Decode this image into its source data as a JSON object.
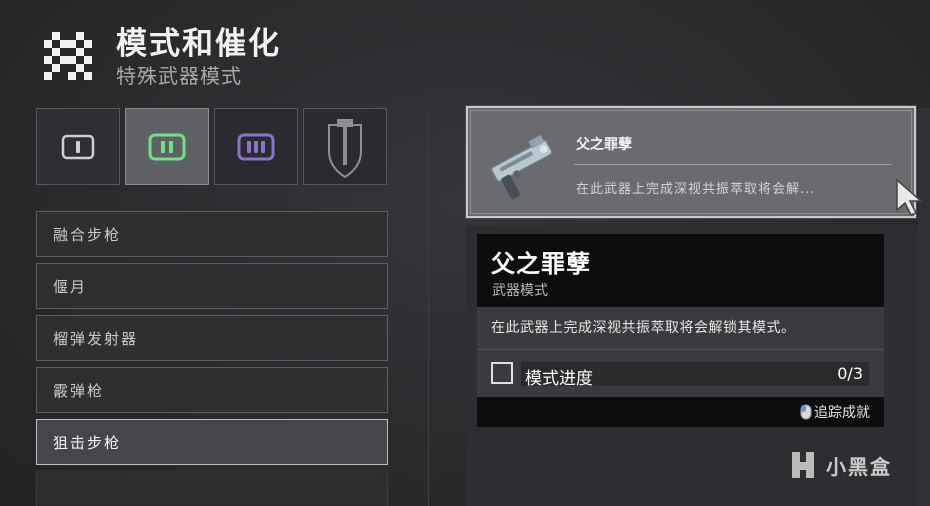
{
  "header": {
    "title": "模式和催化",
    "subtitle": "特殊武器模式",
    "icon": "checker-icon"
  },
  "ammo_tiles": [
    {
      "name": "primary-ammo-icon",
      "color": "#cfcfcf",
      "selected": false
    },
    {
      "name": "special-ammo-icon",
      "color": "#6fe08a",
      "selected": true
    },
    {
      "name": "heavy-ammo-icon",
      "color": "#8a73c9",
      "selected": false
    },
    {
      "name": "sword-shield-icon",
      "color": "#8d8e91",
      "selected": false
    }
  ],
  "weapon_list": {
    "items": [
      {
        "label": "融合步枪",
        "selected": false
      },
      {
        "label": "偃月",
        "selected": false
      },
      {
        "label": "榴弹发射器",
        "selected": false
      },
      {
        "label": "霰弹枪",
        "selected": false
      },
      {
        "label": "狙击步枪",
        "selected": true
      }
    ]
  },
  "mod_card": {
    "name": "父之罪孽",
    "description": "在此武器上完成深视共振萃取将会解..."
  },
  "tooltip": {
    "name": "父之罪孽",
    "type": "武器模式",
    "description": "在此武器上完成深视共振萃取将会解锁其模式。",
    "progress_label": "模式进度",
    "progress_count": "0/3",
    "progress_fraction": 0,
    "track_hint": "追踪成就"
  },
  "watermark": {
    "text": "小黑盒"
  }
}
